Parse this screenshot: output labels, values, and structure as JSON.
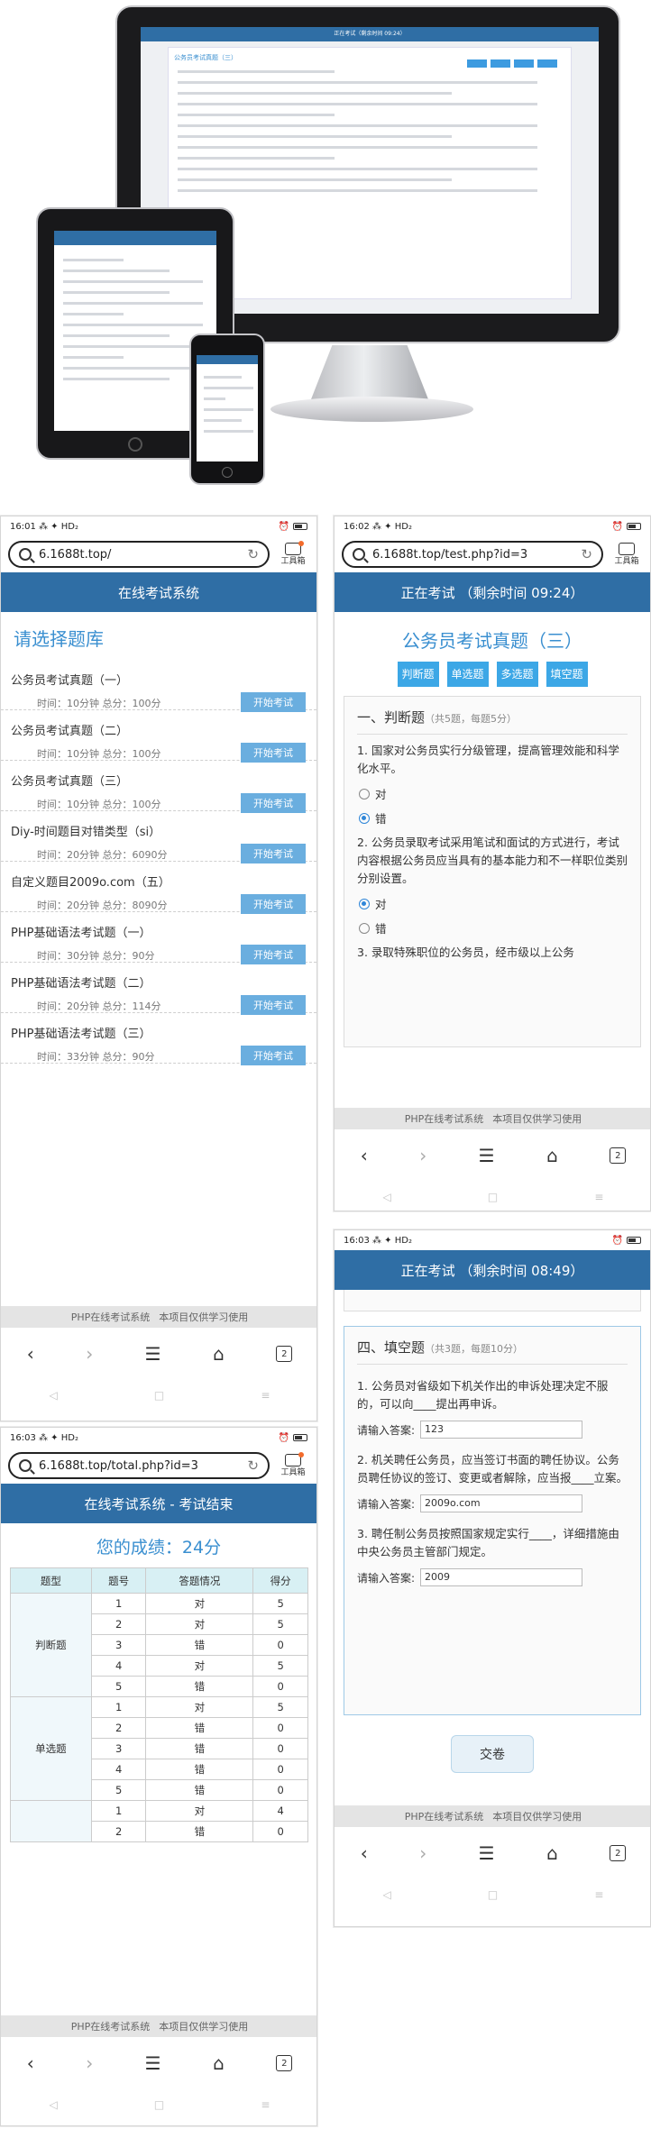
{
  "hero": {
    "monitor_header": "正在考试（剩余时间 09:24）",
    "monitor_title": "公务员考试真题（三）",
    "monitor_footer": "PHP在线考试系统 本项目仅供学习使用"
  },
  "browser": {
    "brand_label": "工具箱",
    "tab_count": "2"
  },
  "footer": {
    "left": "PHP在线考试系统",
    "right": "本项目仅供学习使用"
  },
  "phone1": {
    "time": "16:01",
    "net": "HD₂",
    "url": "6.1688t.top/",
    "title": "在线考试系统",
    "heading": "请选择题库",
    "start_label": "开始考试",
    "items": [
      {
        "name": "公务员考试真题（一）",
        "meta": "时间：10分钟 总分：100分"
      },
      {
        "name": "公务员考试真题（二）",
        "meta": "时间：10分钟 总分：100分"
      },
      {
        "name": "公务员考试真题（三）",
        "meta": "时间：10分钟 总分：100分"
      },
      {
        "name": "Diy-时间题目对错类型（si）",
        "meta": "时间：20分钟 总分：6090分"
      },
      {
        "name": "自定义题目2009o.com（五）",
        "meta": "时间：20分钟 总分：8090分"
      },
      {
        "name": "PHP基础语法考试题（一）",
        "meta": "时间：30分钟 总分：90分"
      },
      {
        "name": "PHP基础语法考试题（二）",
        "meta": "时间：20分钟 总分：114分"
      },
      {
        "name": "PHP基础语法考试题（三）",
        "meta": "时间：33分钟 总分：90分"
      }
    ]
  },
  "phone2": {
    "time": "16:02",
    "net": "HD₂",
    "url": "6.1688t.top/test.php?id=3",
    "title": "正在考试 （剩余时间 09:24）",
    "exam_title": "公务员考试真题（三）",
    "tabs": [
      "判断题",
      "单选题",
      "多选题",
      "填空题"
    ],
    "section": "一、判断题",
    "section_note": "（共5题，每题5分）",
    "q1": "1. 国家对公务员实行分级管理，提高管理效能和科学化水平。",
    "q2": "2. 公务员录取考试采用笔试和面试的方式进行，考试内容根据公务员应当具有的基本能力和不一样职位类别分别设置。",
    "q3": "3. 录取特殊职位的公务员，经市级以上公务",
    "opt_true": "对",
    "opt_false": "错"
  },
  "phone3": {
    "time": "16:03",
    "net": "HD₂",
    "title": "正在考试 （剩余时间 08:49）",
    "section": "四、填空题",
    "section_note": "（共3题，每题10分）",
    "answer_label": "请输入答案:",
    "questions": [
      {
        "text": "1. 公务员对省级如下机关作出的申诉处理决定不服的，可以向____提出再申诉。",
        "answer": "123"
      },
      {
        "text": "2. 机关聘任公务员，应当签订书面的聘任协议。公务员聘任协议的签订、变更或者解除，应当报____立案。",
        "answer": "2009o.com"
      },
      {
        "text": "3. 聘任制公务员按照国家规定实行____，详细措施由中央公务员主管部门规定。",
        "answer": "2009"
      }
    ],
    "submit": "交卷"
  },
  "phone5": {
    "time": "16:03",
    "net": "HD₂",
    "url": "6.1688t.top/total.php?id=3",
    "title": "在线考试系统 - 考试结束",
    "score": "您的成绩：24分",
    "headers": [
      "题型",
      "题号",
      "答题情况",
      "得分"
    ],
    "groups": [
      {
        "type": "判断题",
        "rows": [
          [
            "1",
            "对",
            "5"
          ],
          [
            "2",
            "对",
            "5"
          ],
          [
            "3",
            "错",
            "0"
          ],
          [
            "4",
            "对",
            "5"
          ],
          [
            "5",
            "错",
            "0"
          ]
        ]
      },
      {
        "type": "单选题",
        "rows": [
          [
            "1",
            "对",
            "5"
          ],
          [
            "2",
            "错",
            "0"
          ],
          [
            "3",
            "错",
            "0"
          ],
          [
            "4",
            "错",
            "0"
          ],
          [
            "5",
            "错",
            "0"
          ]
        ]
      },
      {
        "type": "",
        "rows": [
          [
            "1",
            "对",
            "4"
          ],
          [
            "2",
            "错",
            "0"
          ]
        ]
      }
    ]
  }
}
